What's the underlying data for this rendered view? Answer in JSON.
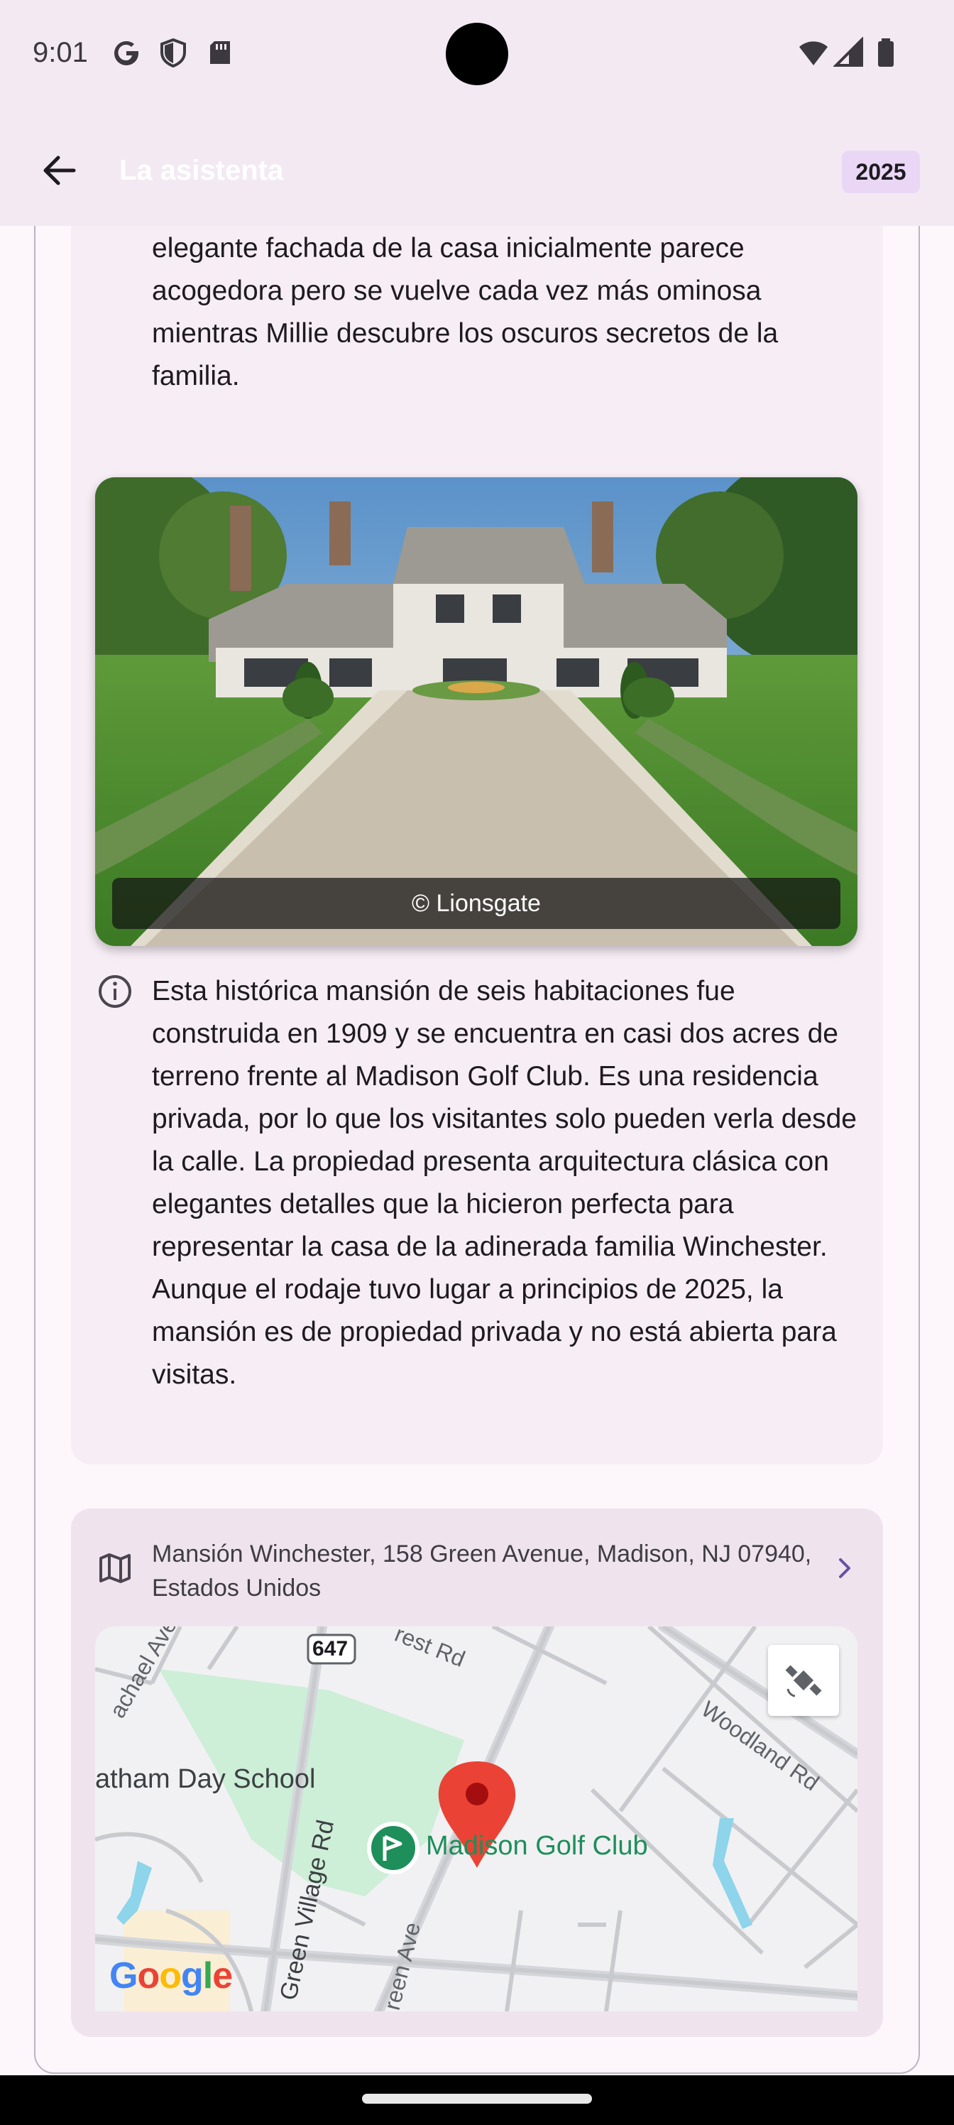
{
  "status_bar": {
    "time": "9:01",
    "left_icons": [
      "google-g-icon",
      "shield-icon",
      "sd-card-icon"
    ],
    "right_icons": [
      "wifi-icon",
      "cellular-signal-icon",
      "battery-icon"
    ]
  },
  "app_bar": {
    "title": "La asistenta",
    "year_badge": "2025",
    "back_icon": "arrow-back-icon"
  },
  "location_detail": {
    "scene_description": "de la película, representando el hogar opulento pero inquietante donde se desarrolla el thriller psicológico. La elegante fachada de la casa inicialmente parece acogedora pero se vuelve cada vez más ominosa mientras Millie descubre los oscuros secretos de la familia.",
    "photo_credit": "© Lionsgate",
    "info_text": "Esta histórica mansión de seis habitaciones fue construida en 1909 y se encuentra en casi dos acres de terreno frente al Madison Golf Club. Es una residencia privada, por lo que los visitantes solo pueden verla desde la calle. La propiedad presenta arquitectura clásica con elegantes detalles que la hicieron perfecta para representar la casa de la adinerada familia Winchester. Aunque el rodaje tuvo lugar a principios de 2025, la mansión es de propiedad privada y no está abierta para visitas."
  },
  "map_section": {
    "address": "Mansión Winchester, 158 Green Avenue, Madison, NJ 07940, Estados Unidos",
    "map_labels": {
      "golf_club": "Madison Golf Club",
      "school": "atham Day School",
      "route": "647",
      "woodland": "Woodland Rd",
      "green_village": "Green Village Rd",
      "green_ave": "reen Ave",
      "crest": "rest Rd",
      "rachael": "achael Ave"
    },
    "logo": "Google",
    "colors": {
      "park": "#cdeed7",
      "golf": "#1e8e5a",
      "marker": "#ea4335",
      "water": "#8ed4ea"
    }
  },
  "theme": {
    "accent": "#6750a4",
    "badge": "#ead7f6",
    "surface": "#f7edf5"
  }
}
